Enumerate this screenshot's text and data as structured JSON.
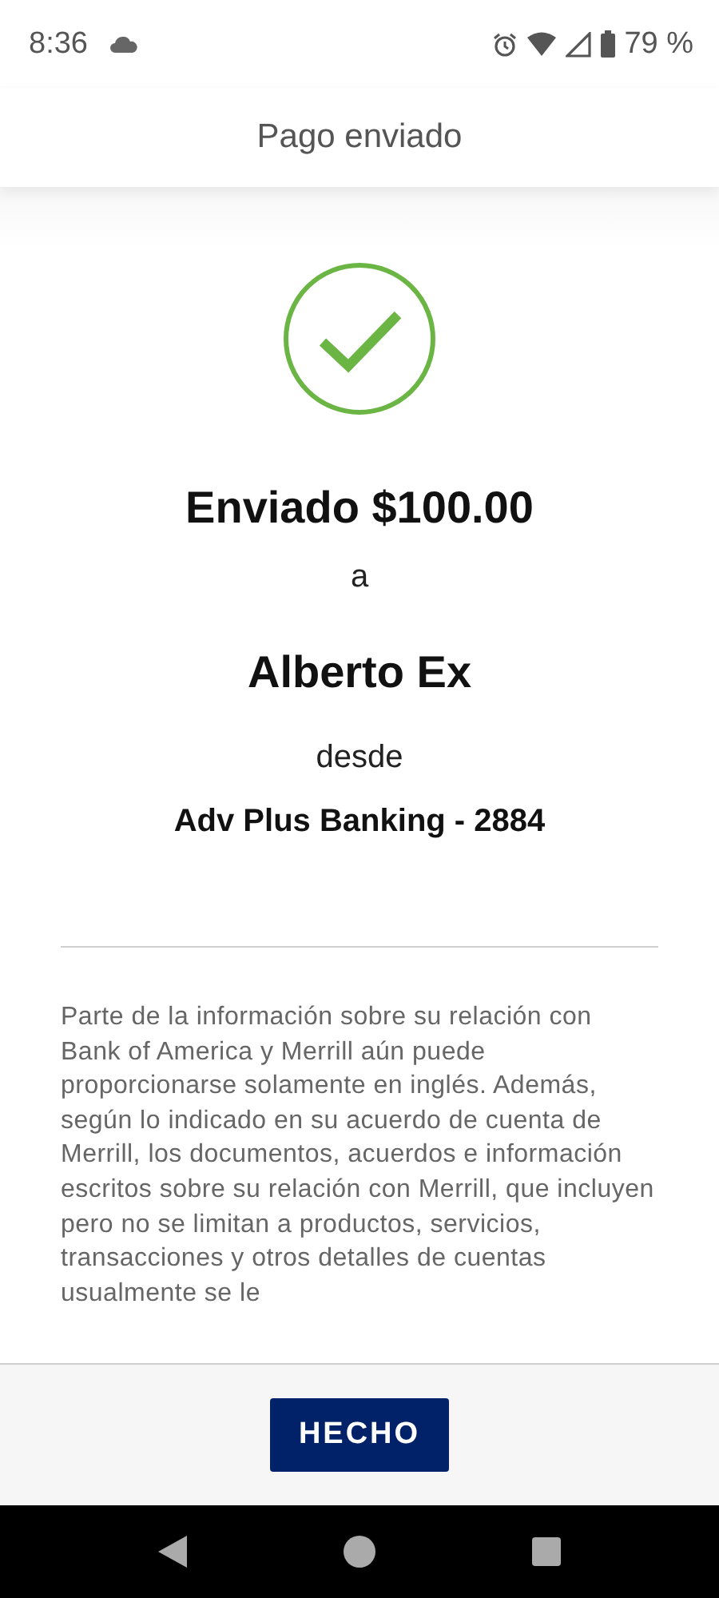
{
  "status_bar": {
    "time": "8:36",
    "battery": "79 %"
  },
  "header": {
    "title": "Pago enviado"
  },
  "confirmation": {
    "amount_line": "Enviado $100.00",
    "to_word": "a",
    "recipient": "Alberto Ex",
    "from_word": "desde",
    "account": "Adv Plus Banking - 2884"
  },
  "disclaimer": "Parte de la información sobre su relación con Bank of America y Merrill aún puede proporcionarse solamente en inglés. Además, según lo indicado en su acuerdo de cuenta de Merrill, los documentos, acuerdos e información escritos sobre su relación con Merrill, que incluyen pero no se limitan a productos, servicios, transacciones y otros detalles de cuentas usualmente se le",
  "buttons": [
    "HECHO"
  ]
}
